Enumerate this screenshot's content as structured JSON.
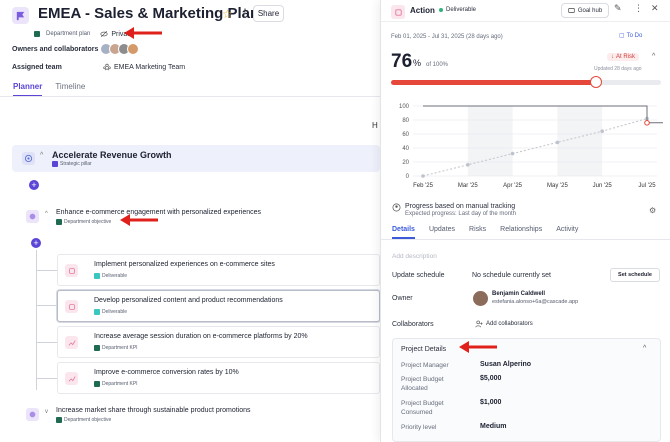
{
  "planner": {
    "title": "EMEA - Sales & Marketing Plan",
    "share_label": "Share",
    "plan_type": "Department plan",
    "privacy": "Private",
    "owners_label": "Owners and collaborators",
    "assigned_team_label": "Assigned team",
    "assigned_team": "EMEA Marketing Team",
    "tabs": [
      {
        "label": "Planner"
      },
      {
        "label": "Timeline"
      }
    ],
    "hint_text": "H",
    "pillar": {
      "title": "Accelerate Revenue Growth",
      "type": "Strategic pillar"
    },
    "objectives": [
      {
        "title": "Enhance e-commerce engagement with personalized experiences",
        "type": "Department objective"
      },
      {
        "title": "Increase market share through sustainable product promotions",
        "type": "Department objective"
      }
    ],
    "items": [
      {
        "title": "Implement personalized experiences on e-commerce sites",
        "type": "Deliverable"
      },
      {
        "title": "Develop personalized content and product recommendations",
        "type": "Deliverable"
      },
      {
        "title": "Increase average session duration on e-commerce platforms by 20%",
        "type": "Department KPI"
      },
      {
        "title": "Improve e-commerce conversion rates by 10%",
        "type": "Department KPI"
      }
    ]
  },
  "panel": {
    "header_title": "Action",
    "header_badge": "Deliverable",
    "goal_hub_label": "Goal hub",
    "date_range": "Feb 01, 2025 - Jul 31, 2025 (28 days ago)",
    "status_todo": "To Do",
    "progress_value": "76",
    "progress_unit": "%",
    "progress_of": "of 100%",
    "progress_fraction": 0.76,
    "risk_label": "At Risk",
    "updated_text": "Updated 28 days ago",
    "progress_basis": "Progress based on manual tracking",
    "expected_progress": "Expected progress: Last day of the month",
    "tabs": [
      {
        "label": "Details"
      },
      {
        "label": "Updates"
      },
      {
        "label": "Risks"
      },
      {
        "label": "Relationships"
      },
      {
        "label": "Activity"
      }
    ],
    "description_placeholder": "Add description",
    "update_schedule_label": "Update schedule",
    "update_schedule_value": "No schedule currently set",
    "set_schedule_label": "Set schedule",
    "owner_label": "Owner",
    "owner_name": "Benjamin Caldwell",
    "owner_email": "estefania.alonso+6a@cascade.app",
    "collaborators_label": "Collaborators",
    "add_collaborators_label": "Add collaborators",
    "project_details": {
      "title": "Project Details",
      "rows": [
        {
          "label": "Project Manager",
          "value": "Susan Alperino"
        },
        {
          "label": "Project Budget Allocated",
          "value": "$5,000"
        },
        {
          "label": "Project Budget Consumed",
          "value": "$1,000"
        },
        {
          "label": "Priority level",
          "value": "Medium"
        }
      ]
    }
  },
  "chart_data": {
    "type": "line",
    "x": [
      "Feb '25",
      "Mar '25",
      "Apr '25",
      "May '25",
      "Jun '25",
      "Jul '25"
    ],
    "yticks": [
      0,
      20,
      40,
      60,
      80,
      100
    ],
    "ylim": [
      0,
      100
    ],
    "series": [
      {
        "values": [
          0,
          16,
          32,
          48,
          64,
          82
        ],
        "style": "dashed"
      },
      {
        "values": [
          100,
          100,
          100,
          100,
          100,
          76
        ],
        "style": "solid"
      }
    ],
    "colors": {
      "expected": "#bfc3cc",
      "actual": "#6b6f7a",
      "current": "#e5473b"
    }
  },
  "colors": {
    "accent": "#5a45d6",
    "risk": "#e5473b",
    "link": "#3b5bdb",
    "deliverable": "#3ac7c0",
    "dept": "#1f6b52"
  }
}
